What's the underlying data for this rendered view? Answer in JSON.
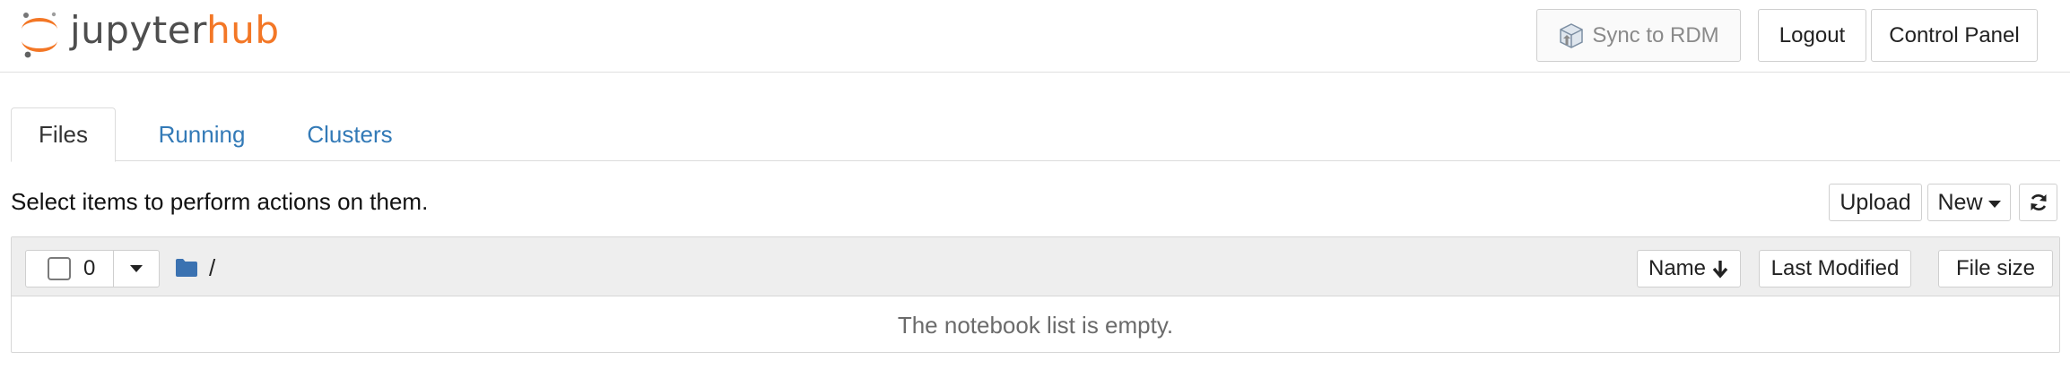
{
  "header": {
    "logo": {
      "text_main": "jupyter",
      "text_accent": "hub"
    },
    "buttons": {
      "sync": "Sync to RDM",
      "logout": "Logout",
      "control_panel": "Control Panel"
    },
    "colors": {
      "logo_orange": "#f37726",
      "logo_gray": "#4e4e4e",
      "link_blue": "#337ab7"
    }
  },
  "tabs": [
    {
      "label": "Files",
      "active": true
    },
    {
      "label": "Running",
      "active": false
    },
    {
      "label": "Clusters",
      "active": false
    }
  ],
  "toolbar": {
    "instructions": "Select items to perform actions on them.",
    "upload_label": "Upload",
    "new_label": "New",
    "refresh_icon": "refresh-icon"
  },
  "file_list": {
    "selected_count": "0",
    "breadcrumb": {
      "icon": "folder-icon",
      "path": "/"
    },
    "columns": {
      "name": "Name",
      "last_modified": "Last Modified",
      "file_size": "File size"
    },
    "empty_message": "The notebook list is empty."
  }
}
